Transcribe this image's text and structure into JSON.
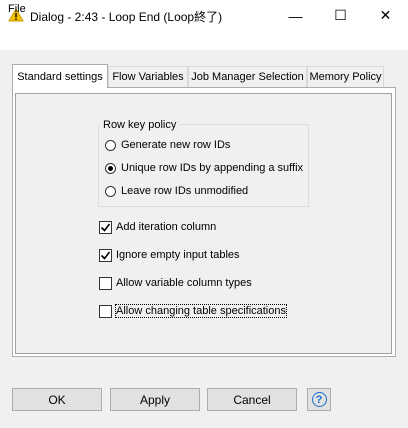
{
  "window": {
    "title": "Dialog - 2:43 - Loop End (Loop終了)",
    "icon": "warning-triangle-icon",
    "minimize_glyph": "—",
    "maximize_glyph": "☐",
    "close_glyph": "✕"
  },
  "menu": {
    "file_label": "File"
  },
  "tabs": [
    {
      "label": "Standard settings",
      "active": true
    },
    {
      "label": "Flow Variables",
      "active": false
    },
    {
      "label": "Job Manager Selection",
      "active": false
    },
    {
      "label": "Memory Policy",
      "active": false
    }
  ],
  "row_key_policy": {
    "title": "Row key policy",
    "options": [
      {
        "label": "Generate new row IDs",
        "selected": false
      },
      {
        "label": "Unique row IDs by appending a suffix",
        "selected": true
      },
      {
        "label": "Leave row IDs unmodified",
        "selected": false
      }
    ]
  },
  "checkboxes": [
    {
      "label": "Add iteration column",
      "checked": true
    },
    {
      "label": "Ignore empty input tables",
      "checked": true
    },
    {
      "label": "Allow variable column types",
      "checked": false
    },
    {
      "label": "Allow changing table specifications",
      "checked": false
    }
  ],
  "buttons": {
    "ok": "OK",
    "apply": "Apply",
    "cancel": "Cancel",
    "help_glyph": "?"
  },
  "colors": {
    "accent": "#1a6fd0",
    "warning": "#f2c200"
  }
}
